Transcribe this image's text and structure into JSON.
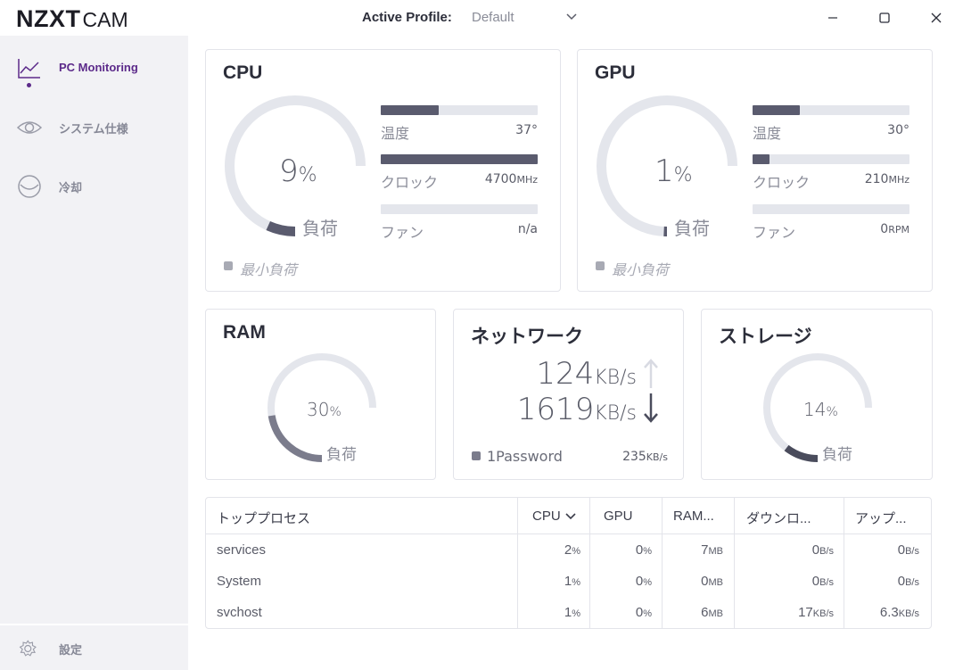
{
  "app": {
    "logo_bold": "NZXT",
    "logo_thin": "CAM"
  },
  "profile": {
    "label": "Active Profile:",
    "value": "Default"
  },
  "sidebar": {
    "items": [
      {
        "label": "PC Monitoring",
        "icon": "chart-line-icon",
        "active": true
      },
      {
        "label": "システム仕様",
        "icon": "eye-icon",
        "active": false
      },
      {
        "label": "冷却",
        "icon": "cooling-icon",
        "active": false
      }
    ],
    "settings_label": "設定"
  },
  "cpu": {
    "title": "CPU",
    "load_value": "9",
    "load_unit": "%",
    "load_fraction": 0.09,
    "load_label": "負荷",
    "temp_label": "温度",
    "temp_value": "37°",
    "temp_fraction": 0.37,
    "clock_label": "クロック",
    "clock_value": "4700",
    "clock_unit": "MHz",
    "clock_fraction": 1.0,
    "fan_label": "ファン",
    "fan_value": "n/a",
    "fan_fraction": 0,
    "min_load_label": "最小負荷"
  },
  "gpu": {
    "title": "GPU",
    "load_value": "1",
    "load_unit": "%",
    "load_fraction": 0.01,
    "load_label": "負荷",
    "temp_label": "温度",
    "temp_value": "30°",
    "temp_fraction": 0.3,
    "clock_label": "クロック",
    "clock_value": "210",
    "clock_unit": "MHz",
    "clock_fraction": 0.11,
    "fan_label": "ファン",
    "fan_value": "0",
    "fan_unit": "RPM",
    "fan_fraction": 0,
    "min_load_label": "最小負荷"
  },
  "ram": {
    "title": "RAM",
    "load_value": "30",
    "load_unit": "%",
    "load_fraction": 0.3,
    "load_label": "負荷"
  },
  "network": {
    "title": "ネットワーク",
    "up_value": "124",
    "up_unit": "KB/s",
    "down_value": "1619",
    "down_unit": "KB/s",
    "top_app": "1Password",
    "top_app_value": "235",
    "top_app_unit": "KB/s"
  },
  "storage": {
    "title": "ストレージ",
    "load_value": "14",
    "load_unit": "%",
    "load_fraction": 0.14,
    "load_label": "負荷"
  },
  "processes": {
    "headers": [
      "トッププロセス",
      "CPU",
      "GPU",
      "RAM...",
      "ダウンロ...",
      "アップ..."
    ],
    "rows": [
      {
        "name": "services",
        "cpu": "2",
        "cpu_unit": "%",
        "gpu": "0",
        "gpu_unit": "%",
        "ram": "7",
        "ram_unit": "MB",
        "down": "0",
        "down_unit": "B/s",
        "up": "0",
        "up_unit": "B/s"
      },
      {
        "name": "System",
        "cpu": "1",
        "cpu_unit": "%",
        "gpu": "0",
        "gpu_unit": "%",
        "ram": "0",
        "ram_unit": "MB",
        "down": "0",
        "down_unit": "B/s",
        "up": "0",
        "up_unit": "B/s"
      },
      {
        "name": "svchost",
        "cpu": "1",
        "cpu_unit": "%",
        "gpu": "0",
        "gpu_unit": "%",
        "ram": "6",
        "ram_unit": "MB",
        "down": "17",
        "down_unit": "KB/s",
        "up": "6.3",
        "up_unit": "KB/s"
      }
    ]
  },
  "colors": {
    "accent": "#5c2a8a",
    "gauge_track": "#e4e6ec",
    "gauge_fill": "#5a5b6e"
  }
}
